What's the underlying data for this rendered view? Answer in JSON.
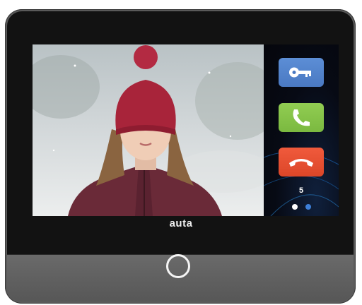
{
  "device": {
    "brand": "auta",
    "page_indicator": "5",
    "pages": {
      "count": 2,
      "active": 1
    }
  },
  "video": {
    "caption": ""
  },
  "controls": [
    {
      "name": "unlock",
      "icon": "key-icon",
      "color": "#4a79c2"
    },
    {
      "name": "answer",
      "icon": "phone-icon",
      "color": "#7bb940"
    },
    {
      "name": "hang-up",
      "icon": "hang-up-icon",
      "color": "#dc4628"
    }
  ],
  "home_button": {
    "icon": "ring-icon"
  }
}
